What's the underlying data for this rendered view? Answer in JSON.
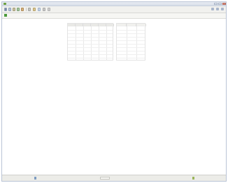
{
  "window": {
    "title": ""
  },
  "menubar": {
    "items": [
      {
        "label": ""
      },
      {
        "label": ""
      },
      {
        "label": ""
      },
      {
        "label": ""
      },
      {
        "label": ""
      },
      {
        "label": ""
      }
    ]
  },
  "statusbar": {
    "left_text": "",
    "middle_text": "",
    "right_text": ""
  },
  "icons": {
    "app": "app-icon",
    "minimize": "minimize-icon",
    "maximize": "maximize-icon",
    "close": "close-icon"
  }
}
